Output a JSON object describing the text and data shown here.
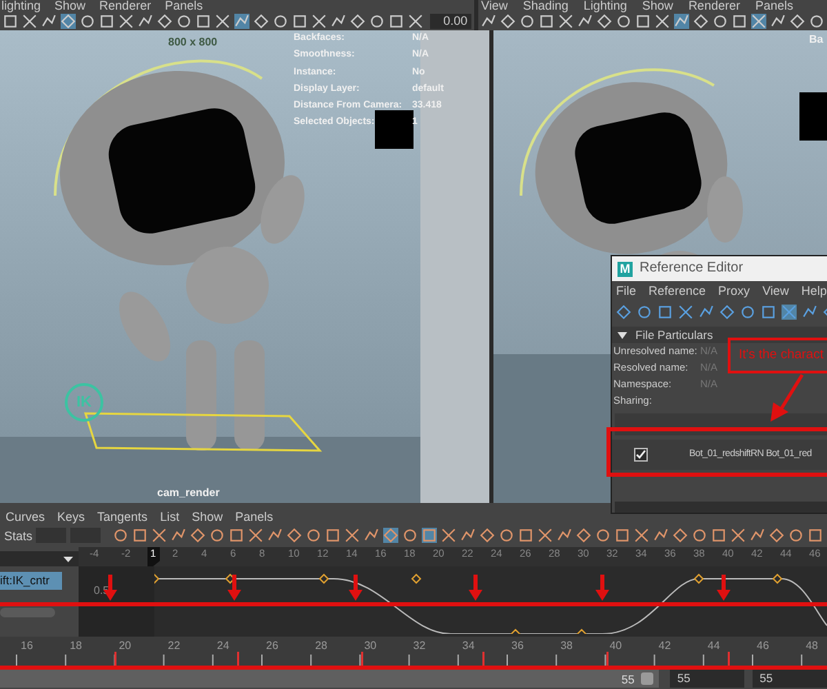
{
  "left_viewport": {
    "menu": [
      "lighting",
      "Show",
      "Renderer",
      "Panels"
    ],
    "toolbar_value": "0.00",
    "resolution": "800 x 800",
    "hud": [
      {
        "label": "Backfaces:",
        "value": "N/A"
      },
      {
        "label": "Smoothness:",
        "value": "N/A"
      },
      {
        "label": "Instance:",
        "value": "No"
      },
      {
        "label": "Display Layer:",
        "value": "default"
      },
      {
        "label": "Distance From Camera:",
        "value": "33.418"
      },
      {
        "label": "Selected Objects:",
        "value": "1"
      }
    ],
    "ik_badge": "IK",
    "camera": "cam_render"
  },
  "right_viewport": {
    "menu": [
      "View",
      "Shading",
      "Lighting",
      "Show",
      "Renderer",
      "Panels"
    ],
    "hud_label": "Ba"
  },
  "reference_editor": {
    "app_icon_letter": "M",
    "title": "Reference Editor",
    "menu": [
      "File",
      "Reference",
      "Proxy",
      "View",
      "Help"
    ],
    "section": "File Particulars",
    "fields": [
      {
        "label": "Unresolved name:",
        "value": "N/A"
      },
      {
        "label": "Resolved name:",
        "value": "N/A"
      },
      {
        "label": "Namespace:",
        "value": "N/A"
      },
      {
        "label": "Sharing:"
      }
    ],
    "references": [
      {
        "name": "Bot_01_redshiftRN Bot_01_red",
        "checked": true
      }
    ]
  },
  "annotation": {
    "note": "It's the charact"
  },
  "graph_editor": {
    "menu": [
      "Curves",
      "Keys",
      "Tangents",
      "List",
      "Show",
      "Panels"
    ],
    "stats_label": "Stats",
    "ruler": [
      "-4",
      "-2",
      "1",
      "2",
      "4",
      "6",
      "8",
      "10",
      "12",
      "14",
      "16",
      "18",
      "20",
      "22",
      "24",
      "26",
      "28",
      "30",
      "32",
      "34",
      "36",
      "38",
      "40",
      "42",
      "44",
      "46"
    ],
    "outliner_items": [
      {
        "label": "ift:IK_cntr",
        "selected": true
      }
    ],
    "value_label": "0.5"
  },
  "time_slider": {
    "labels": [
      "16",
      "18",
      "20",
      "22",
      "24",
      "26",
      "28",
      "30",
      "32",
      "34",
      "36",
      "38",
      "40",
      "42",
      "44",
      "46",
      "48"
    ]
  },
  "range": {
    "current": "55",
    "level": 1,
    "start": "55",
    "end": "55"
  }
}
